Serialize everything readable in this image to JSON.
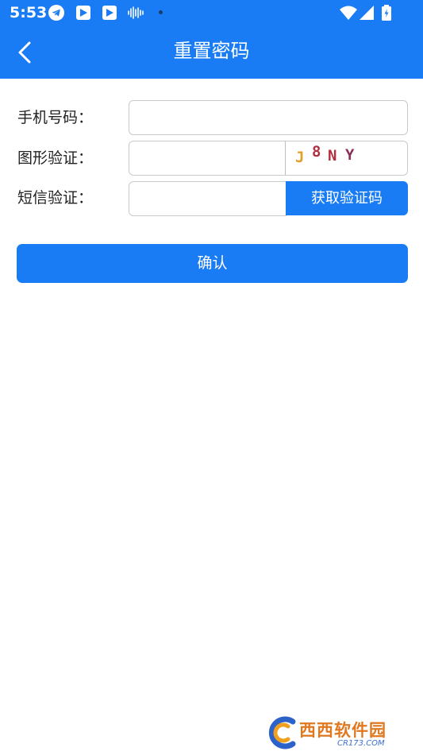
{
  "status_bar": {
    "time": "5:53",
    "icons": [
      "telegram-icon",
      "play-store-icon",
      "play-store-icon",
      "audio-wave-icon",
      "dot-icon",
      "wifi-icon",
      "signal-icon",
      "battery-icon"
    ]
  },
  "header": {
    "title": "重置密码"
  },
  "form": {
    "phone_label": "手机号码：",
    "phone_value": "",
    "captcha_label": "图形验证：",
    "captcha_value": "",
    "captcha_chars": [
      "J",
      "8",
      "N",
      "Y"
    ],
    "sms_label": "短信验证：",
    "sms_value": "",
    "sms_button": "获取验证码",
    "confirm_button": "确认"
  },
  "watermark": {
    "text": "西西软件园",
    "subtext": "CR173.COM"
  },
  "colors": {
    "primary": "#1a7cf4",
    "background": "#ffffff",
    "border": "#c9c9c9",
    "captcha_j": "#e0a02a",
    "captcha_8": "#b03040",
    "captcha_n": "#b03040",
    "captcha_y": "#8a2f5a"
  }
}
